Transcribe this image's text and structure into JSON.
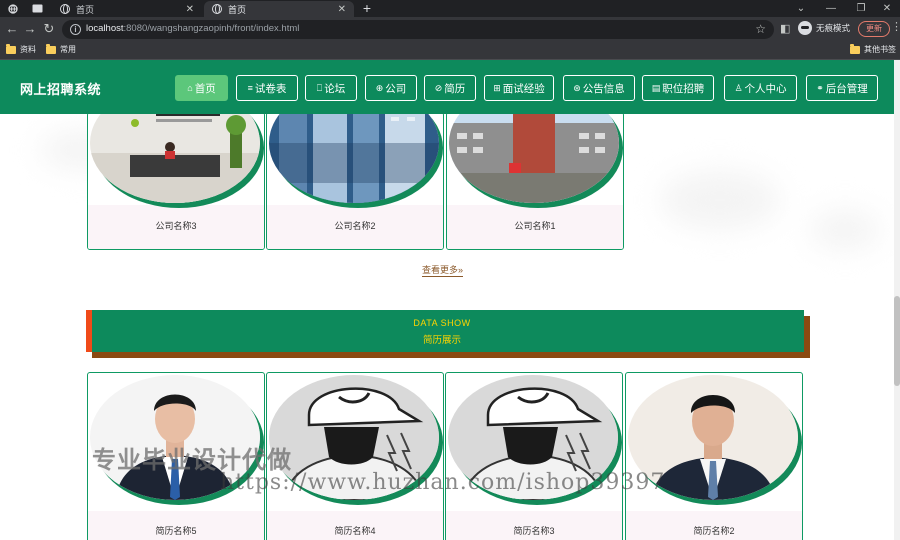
{
  "browser": {
    "tabs": [
      {
        "title": "首页"
      },
      {
        "title": "首页"
      }
    ],
    "url": {
      "host": "localhost",
      "path": ":8080/wangshangzaopinh/front/index.html"
    },
    "profile_label": "无痕模式",
    "update_label": "更新",
    "bookmarks": [
      {
        "label": "资料"
      },
      {
        "label": "常用"
      },
      {
        "label": "其他书签"
      }
    ]
  },
  "site": {
    "title": "网上招聘系统",
    "accent_color": "#0d8a5c",
    "nav": [
      {
        "label": "首页",
        "icon": "home-icon",
        "glyph": "⌂",
        "active": true
      },
      {
        "label": "试卷表",
        "icon": "list-icon",
        "glyph": "≡"
      },
      {
        "label": "论坛",
        "icon": "bookmark-icon",
        "glyph": "⎕"
      },
      {
        "label": "公司",
        "icon": "globe-icon",
        "glyph": "⊕"
      },
      {
        "label": "简历",
        "icon": "link-icon",
        "glyph": "⊘"
      },
      {
        "label": "面试经验",
        "icon": "book-icon",
        "glyph": "⊞"
      },
      {
        "label": "公告信息",
        "icon": "compass-icon",
        "glyph": "⊛"
      },
      {
        "label": "职位招聘",
        "icon": "document-icon",
        "glyph": "▤"
      },
      {
        "label": "个人中心",
        "icon": "user-icon",
        "glyph": "♙"
      },
      {
        "label": "后台管理",
        "icon": "link-icon",
        "glyph": "⚭"
      }
    ]
  },
  "companies": {
    "items": [
      {
        "name": "公司名称3",
        "image": "office-reception-photo"
      },
      {
        "name": "公司名称2",
        "image": "city-building-photo"
      },
      {
        "name": "公司名称1",
        "image": "school-campus-photo"
      }
    ],
    "view_more": "查看更多"
  },
  "resume_section": {
    "title_en": "DATA SHOW",
    "title_cn": "简历展示",
    "items": [
      {
        "name": "简历名称5",
        "image": "man-in-suit-photo"
      },
      {
        "name": "简历名称4",
        "image": "cartoon-cap-illustration"
      },
      {
        "name": "简历名称3",
        "image": "cartoon-cap-illustration"
      },
      {
        "name": "简历名称2",
        "image": "young-man-photo"
      }
    ]
  },
  "watermark": {
    "cn": "专业毕业设计代做",
    "url": "https://www.huzhan.com/ishop39397"
  }
}
